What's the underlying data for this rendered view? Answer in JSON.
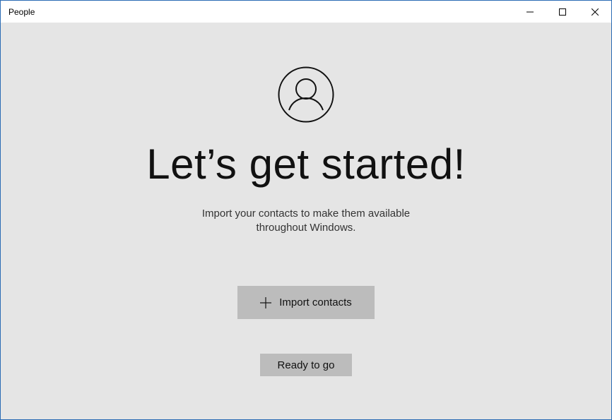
{
  "window": {
    "title": "People",
    "border_color": "#2b6cb5",
    "controls": [
      "minimize-icon",
      "maximize-icon",
      "close-icon"
    ]
  },
  "main": {
    "avatar_icon": "person-circle-icon",
    "heading": "Let’s get started!",
    "subtitle_line1": "Import your contacts to make them available",
    "subtitle_line2": "throughout Windows."
  },
  "buttons": {
    "import_icon": "plus-icon",
    "import_label": "Import contacts",
    "ready_label": "Ready to go"
  },
  "colors": {
    "background": "#e5e5e5",
    "button": "#bcbcbc",
    "text": "#111111"
  }
}
